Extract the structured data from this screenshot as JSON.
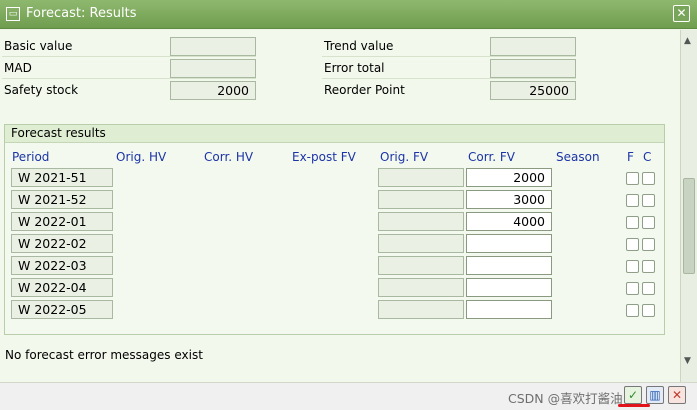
{
  "window": {
    "title": "Forecast: Results",
    "close_glyph": "✕",
    "title_glyph": "▭"
  },
  "summary": {
    "basic_value_label": "Basic value",
    "basic_value": "",
    "mad_label": "MAD",
    "mad": "",
    "safety_stock_label": "Safety stock",
    "safety_stock": "2000",
    "trend_value_label": "Trend value",
    "trend_value": "",
    "error_total_label": "Error total",
    "error_total": "",
    "reorder_point_label": "Reorder Point",
    "reorder_point": "25000"
  },
  "forecast": {
    "group_title": "Forecast results",
    "headers": {
      "period": "Period",
      "orig_hv": "Orig. HV",
      "corr_hv": "Corr. HV",
      "expost_fv": "Ex-post FV",
      "orig_fv": "Orig. FV",
      "corr_fv": "Corr. FV",
      "season": "Season",
      "f": "F",
      "c": "C"
    },
    "rows": [
      {
        "period": "W 2021-51",
        "corr_fv": "2000"
      },
      {
        "period": "W 2021-52",
        "corr_fv": "3000"
      },
      {
        "period": "W 2022-01",
        "corr_fv": "4000"
      },
      {
        "period": "W 2022-02",
        "corr_fv": ""
      },
      {
        "period": "W 2022-03",
        "corr_fv": ""
      },
      {
        "period": "W 2022-04",
        "corr_fv": ""
      },
      {
        "period": "W 2022-05",
        "corr_fv": ""
      }
    ]
  },
  "status_message": "No forecast error messages exist",
  "scrollbar": {
    "up_glyph": "▲",
    "down_glyph": "▼"
  },
  "footer": {
    "watermark": "CSDN @喜欢打酱油",
    "buttons": [
      {
        "glyph": "✓",
        "color": "#2e8b2e"
      },
      {
        "glyph": "▥",
        "color": "#2a5db0"
      },
      {
        "glyph": "✕",
        "color": "#c0392b"
      }
    ]
  },
  "colors": {
    "title_bar": "#7aa85a",
    "header_text": "#1c34a8",
    "annotation": "#e0141a"
  }
}
